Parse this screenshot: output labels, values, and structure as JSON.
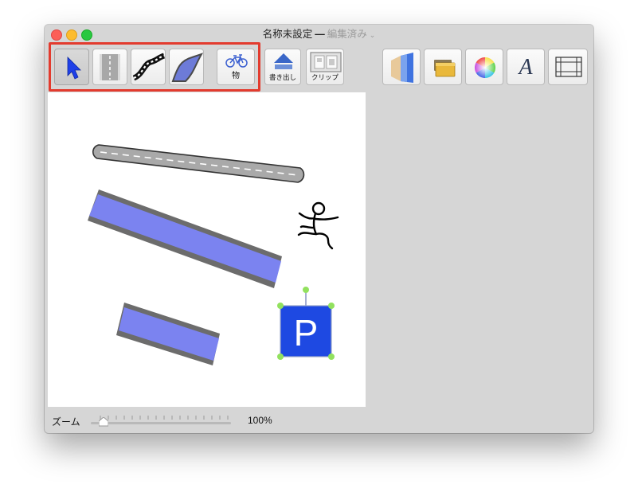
{
  "window": {
    "title": "名称未設定",
    "separator": "—",
    "status": "編集済み",
    "status_chevron": "chevron-down-icon"
  },
  "toolbar": {
    "tools": [
      {
        "name": "select-tool",
        "icon": "arrow-pointer-icon",
        "selected": true
      },
      {
        "name": "road-tool",
        "icon": "straight-road-icon"
      },
      {
        "name": "curved-road-tool",
        "icon": "curved-road-icon"
      },
      {
        "name": "river-tool",
        "icon": "river-icon"
      },
      {
        "name": "object-tool",
        "icon": "bicycle-icon",
        "label": "物"
      }
    ],
    "export": {
      "icon": "upload-arrow-icon",
      "label": "書き出し"
    },
    "clip": {
      "icon": "clipboard-icon",
      "label": "クリップ"
    },
    "right_buttons": [
      {
        "name": "layers-button",
        "icon": "layers-icon"
      },
      {
        "name": "folder-button",
        "icon": "folder-icon"
      },
      {
        "name": "colors-button",
        "icon": "color-wheel-icon"
      },
      {
        "name": "fonts-button",
        "icon": "font-icon",
        "glyph": "A"
      },
      {
        "name": "grid-button",
        "icon": "grid-icon"
      }
    ],
    "highlight_color": "#e33b2e"
  },
  "canvas": {
    "objects": [
      {
        "name": "gray-road",
        "icon": "road-with-dashed-line",
        "color": "#aaaaaa"
      },
      {
        "name": "blue-river-large",
        "icon": "river",
        "color": "#7b83f0"
      },
      {
        "name": "blue-river-small",
        "icon": "river",
        "color": "#7b83f0"
      },
      {
        "name": "running-person",
        "icon": "stick-figure-icon"
      },
      {
        "name": "parking-sign",
        "icon": "parking-sign",
        "text": "P",
        "color": "#1e49e2",
        "selected": true
      }
    ]
  },
  "footer": {
    "zoom_label": "ズーム",
    "zoom_value": "100%"
  }
}
